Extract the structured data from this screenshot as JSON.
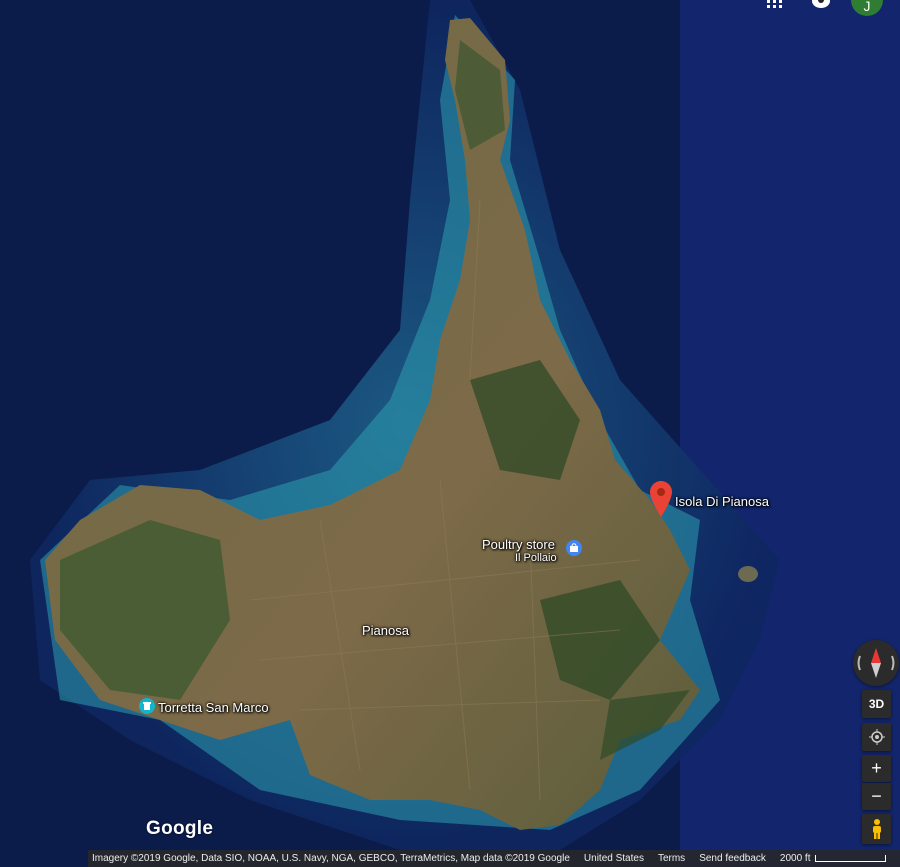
{
  "map": {
    "view": "satellite",
    "place_pin": {
      "label": "Isola Di Pianosa",
      "color": "#ea4335"
    },
    "poi": [
      {
        "name": "Poultry store",
        "sub": "Il Pollaio",
        "icon": "shopping-bag-icon",
        "color": "#4285f4"
      },
      {
        "name": "Torretta San Marco",
        "icon": "landmark-icon",
        "color": "#12b5cb"
      }
    ],
    "area_label": "Pianosa"
  },
  "header": {
    "apps_icon": "apps-grid-icon",
    "notifications_icon": "notifications-icon",
    "avatar_letter": "J"
  },
  "controls": {
    "compass_icon": "compass-icon",
    "tilt_label": "3D",
    "location_icon": "my-location-icon",
    "zoom_in": "+",
    "zoom_out": "−",
    "pegman_icon": "pegman-icon"
  },
  "branding": {
    "logo": "Google"
  },
  "footer": {
    "attribution": "Imagery ©2019 Google, Data SIO, NOAA, U.S. Navy, NGA, GEBCO, TerraMetrics, Map data ©2019 Google",
    "country": "United States",
    "terms": "Terms",
    "feedback": "Send feedback",
    "scale": "2000 ft"
  }
}
